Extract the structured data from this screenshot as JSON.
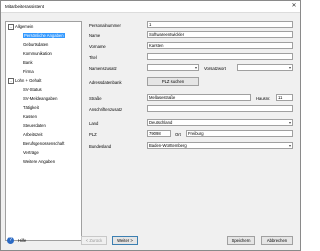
{
  "window": {
    "title": "Mitarbeiterassistent",
    "close_glyph": "✕"
  },
  "tree": {
    "nodes": [
      {
        "label": "Allgemein",
        "level": 1,
        "expander": "-"
      },
      {
        "label": "Persönliche Angaben",
        "level": 2,
        "selected": true
      },
      {
        "label": "Geburtsdaten",
        "level": 2
      },
      {
        "label": "Kommunikation",
        "level": 2
      },
      {
        "label": "Bank",
        "level": 2
      },
      {
        "label": "Firma",
        "level": 2
      },
      {
        "label": "Lohn + Gehalt",
        "level": 1,
        "expander": "-"
      },
      {
        "label": "SV-Status",
        "level": 2
      },
      {
        "label": "SV-Meldeangaben",
        "level": 2
      },
      {
        "label": "Tätigkeit",
        "level": 2
      },
      {
        "label": "Kassen",
        "level": 2
      },
      {
        "label": "Steuerdaten",
        "level": 2
      },
      {
        "label": "Arbeitszeit",
        "level": 2
      },
      {
        "label": "Berufsgenossenschaft",
        "level": 2
      },
      {
        "label": "Verträge",
        "level": 2
      },
      {
        "label": "Weitere Angaben",
        "level": 2
      }
    ]
  },
  "form": {
    "personalnummer": {
      "label": "Personalnummer",
      "value": "1"
    },
    "name": {
      "label": "Name",
      "value": "Softwareentwickler"
    },
    "vorname": {
      "label": "Vorname",
      "value": "Karsten"
    },
    "titel": {
      "label": "Titel",
      "value": ""
    },
    "namenszusatz": {
      "label": "Namenszusatz",
      "value": ""
    },
    "vorsatzwort": {
      "label": "Vorsatzwort",
      "value": ""
    },
    "adressdatenbank": {
      "label": "Adressdatenbank",
      "button": "PLZ suchen"
    },
    "strasse": {
      "label": "Straße",
      "value": "Mellasestraße"
    },
    "hausnr": {
      "label": "Hausnr.",
      "value": "11"
    },
    "anschriftenzusatz": {
      "label": "Anschriftenzusatz",
      "value": ""
    },
    "land": {
      "label": "Land",
      "value": "Deutschland"
    },
    "plz": {
      "label": "PLZ",
      "value": "79098"
    },
    "ort": {
      "label": "Ort",
      "value": "Freiburg"
    },
    "bundesland": {
      "label": "Bundesland",
      "value": "Baden-Württemberg"
    }
  },
  "footer": {
    "help": "Hilfe",
    "back": "< Zurück",
    "next": "Weiter >",
    "save": "Speichern",
    "cancel": "Abbrechen"
  }
}
